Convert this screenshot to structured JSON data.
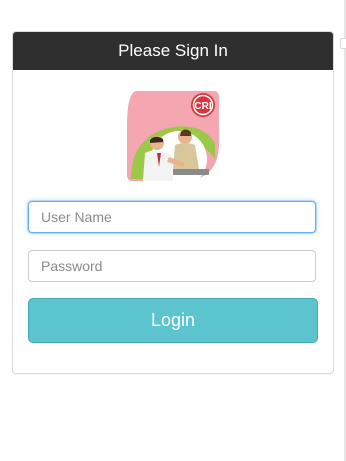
{
  "panel": {
    "title": "Please Sign In"
  },
  "logo": {
    "icon": "cri-people-logo",
    "badge_text": "CRI"
  },
  "form": {
    "username_placeholder": "User Name",
    "username_value": "",
    "password_placeholder": "Password",
    "password_value": "",
    "login_label": "Login"
  },
  "colors": {
    "header_bg": "#2f2f2f",
    "login_button": "#5bc4cf",
    "focus_border": "#66afe9",
    "logo_pink": "#f4a7b1",
    "logo_green": "#9cc84a"
  }
}
